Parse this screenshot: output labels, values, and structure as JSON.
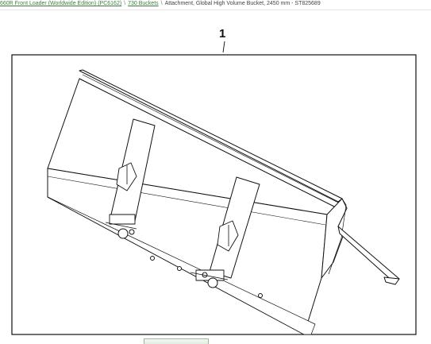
{
  "breadcrumb": {
    "items": [
      {
        "label": "660R Front Loader (Worldwide Edition) (PC6162)",
        "link": true
      },
      {
        "label": "730 Buckets",
        "link": true
      },
      {
        "label": "Attachment, Global High Volume Bucket, 2450 mm - ST825689",
        "link": false
      }
    ],
    "separator": "\\",
    "link_color": "#3f7e3f"
  },
  "diagram": {
    "callout": "1",
    "subject": "high-volume-bucket-illustration"
  }
}
